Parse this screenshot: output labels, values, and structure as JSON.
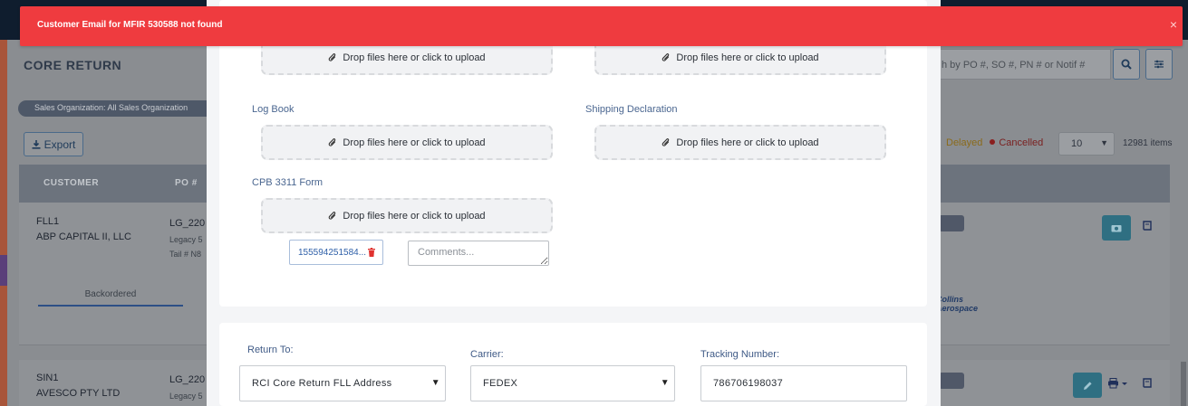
{
  "background": {
    "page_title": "CORE RETURN",
    "search_placeholder": "h by PO #, SO #, PN # or Notif #",
    "sales_org_chip": "Sales Organization: All Sales Organization",
    "export_label": "Export",
    "legend": {
      "delayed": "Delayed",
      "cancelled": "Cancelled"
    },
    "page_size": "10",
    "total_items": "12981 items",
    "columns": {
      "customer": "CUSTOMER",
      "po": "PO #"
    },
    "rows": [
      {
        "customer_code": "FLL1",
        "customer_name": "ABP CAPITAL II, LLC",
        "po": "LG_220",
        "line2": "Legacy 5",
        "line3": "Tail # N8"
      },
      {
        "customer_code": "SIN1",
        "customer_name": "AVESCO PTY LTD",
        "po": "LG_220",
        "line2": "Legacy 5"
      }
    ],
    "tab_backordered": "Backordered",
    "logo_text_1": "Collins",
    "logo_text_2": "Aerospace"
  },
  "modal": {
    "upload_prompt": "Drop files here or click to upload",
    "labels": {
      "log_book": "Log Book",
      "shipping_declaration": "Shipping Declaration",
      "cpb_form": "CPB 3311 Form"
    },
    "attachment_name": "155594251584...",
    "comments_placeholder": "Comments...",
    "shipping": {
      "return_to_label": "Return To:",
      "return_to_value": "RCI Core Return FLL Address",
      "carrier_label": "Carrier:",
      "carrier_value": "FEDEX",
      "tracking_label": "Tracking Number:",
      "tracking_value": "786706198037"
    }
  },
  "toast": {
    "message": "Customer Email for MFIR 530588 not found",
    "close_glyph": "×"
  },
  "colors": {
    "toast_bg": "#ef3b3f",
    "label_blue": "#4a6690",
    "link_blue": "#2e5fa8",
    "trash_red": "#e0322f"
  }
}
